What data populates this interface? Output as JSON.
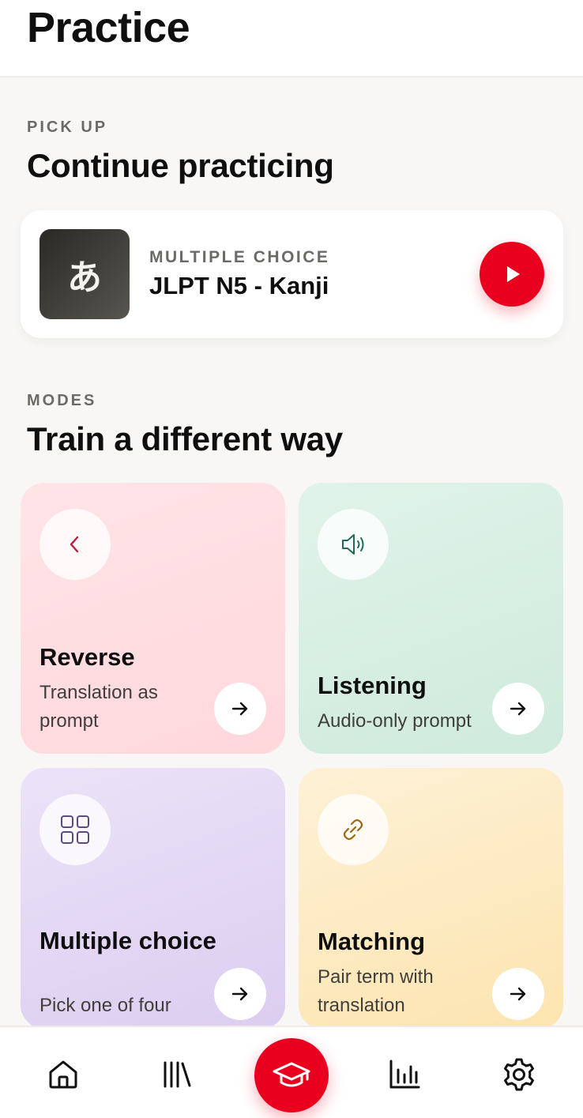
{
  "header": {
    "title": "Practice"
  },
  "pickup": {
    "eyebrow": "PICK UP",
    "title": "Continue practicing",
    "card": {
      "thumb_glyph": "あ",
      "mode": "MULTIPLE CHOICE",
      "deck": "JLPT N5 - Kanji",
      "play_icon": "play-icon"
    }
  },
  "modes": {
    "eyebrow": "MODES",
    "title": "Train a different way",
    "items": [
      {
        "title": "Reverse",
        "description": "Translation as prompt",
        "icon": "chevron-left-icon",
        "color": "#ffdde1",
        "icon_color": "#c2183b"
      },
      {
        "title": "Listening",
        "description": "Audio-only prompt",
        "icon": "speaker-icon",
        "color": "#d8efe3",
        "icon_color": "#1f6b55"
      },
      {
        "title": "Multiple choice",
        "description": "Pick one of four",
        "icon": "grid-icon",
        "color": "#e4d9f5",
        "icon_color": "#5b4a86"
      },
      {
        "title": "Matching",
        "description": "Pair term with translation",
        "icon": "link-icon",
        "color": "#fdebc4",
        "icon_color": "#9a6a12"
      }
    ]
  },
  "bottom_nav": {
    "items": [
      "home-icon",
      "library-icon",
      "practice-icon",
      "stats-icon",
      "settings-icon"
    ],
    "active": "practice-icon"
  },
  "colors": {
    "accent": "#e8001e",
    "background": "#f8f7f5"
  }
}
